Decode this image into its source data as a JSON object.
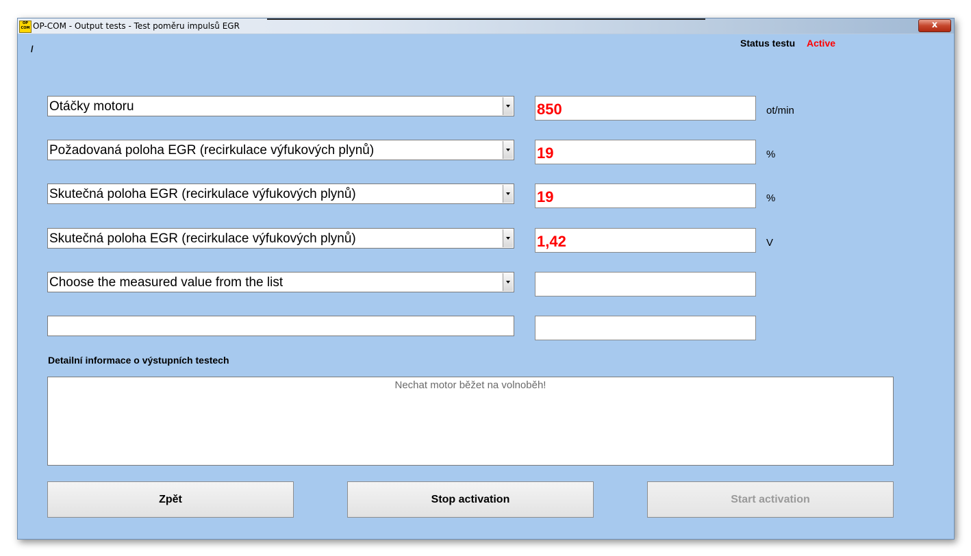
{
  "window": {
    "title": "OP-COM - Output tests - Test poměru impulsů EGR",
    "icon_text": "OP COM",
    "close_label": "x",
    "path_marker": "/"
  },
  "status": {
    "label": "Status testu",
    "value": "Active",
    "value_color": "#ff0000"
  },
  "rows": [
    {
      "parameter": "Otáčky motoru",
      "value": "850",
      "unit": "ot/min"
    },
    {
      "parameter": "Požadovaná poloha EGR (recirkulace výfukových plynů)",
      "value": "19",
      "unit": "%"
    },
    {
      "parameter": "Skutečná poloha EGR (recirkulace výfukových plynů)",
      "value": "19",
      "unit": "%"
    },
    {
      "parameter": "Skutečná poloha EGR (recirkulace výfukových plynů)",
      "value": "1,42",
      "unit": "V"
    },
    {
      "parameter": "Choose the measured value from the list",
      "value": "",
      "unit": ""
    },
    {
      "parameter": "",
      "value": "",
      "unit": ""
    }
  ],
  "details": {
    "label": "Detailní informace o výstupních testech",
    "text": "Nechat motor běžet na volnoběh!"
  },
  "buttons": {
    "back": "Zpět",
    "stop": "Stop activation",
    "start": "Start activation"
  },
  "colors": {
    "background": "#a7c9ee",
    "value_text": "#ff0000"
  }
}
